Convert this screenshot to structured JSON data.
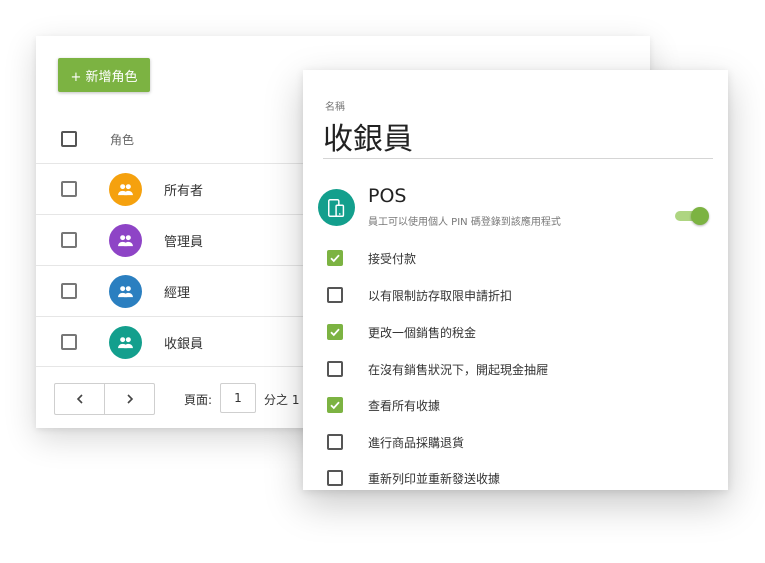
{
  "roles_panel": {
    "add_button_label": "+ 新增角色",
    "column_header": "角色",
    "rows": [
      {
        "label": "所有者",
        "avatar_color": "#f5a10e"
      },
      {
        "label": "管理員",
        "avatar_color": "#8e44c6"
      },
      {
        "label": "經理",
        "avatar_color": "#2b7fc0"
      },
      {
        "label": "收銀員",
        "avatar_color": "#139f8d"
      }
    ],
    "pagination": {
      "prev_icon": "chevron-left-icon",
      "next_icon": "chevron-right-icon",
      "page_label": "頁面:",
      "page_value": "1",
      "page_of": "分之 1"
    }
  },
  "detail_panel": {
    "name_label": "名稱",
    "name_value": "收銀員",
    "section": {
      "icon": "pos-devices-icon",
      "icon_color": "#139f8d",
      "title": "POS",
      "description": "員工可以使用個人 PIN 碼登錄到該應用程式",
      "toggle_on": true
    },
    "permissions": [
      {
        "label": "接受付款",
        "checked": true
      },
      {
        "label": "以有限制訪存取限申請折扣",
        "checked": false
      },
      {
        "label": "更改一個銷售的稅金",
        "checked": true
      },
      {
        "label": "在沒有銷售狀況下，開起現金抽屜",
        "checked": false
      },
      {
        "label": "查看所有收據",
        "checked": true
      },
      {
        "label": "進行商品採購退貨",
        "checked": false
      },
      {
        "label": "重新列印並重新發送收據",
        "checked": false
      }
    ]
  },
  "colors": {
    "accent_green": "#7cb342",
    "toggle_track": "#aed581"
  }
}
